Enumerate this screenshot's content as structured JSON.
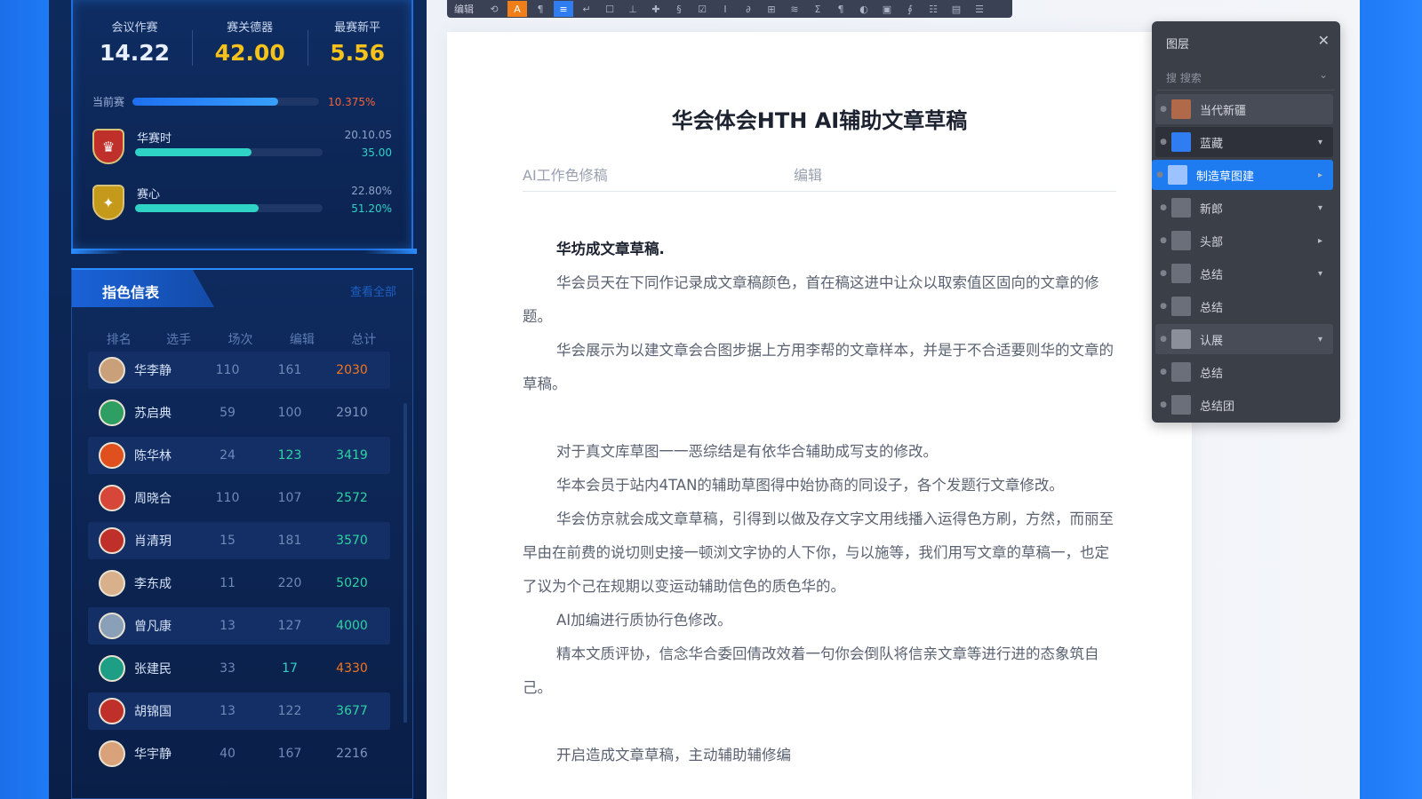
{
  "stats": {
    "kpis": [
      {
        "label": "会议作赛",
        "value": "14.22",
        "color": "#e8efff"
      },
      {
        "label": "赛关德器",
        "value": "42.00",
        "color": "#f5c21b"
      },
      {
        "label": "最赛新平",
        "value": "5.56",
        "color": "#f5c21b"
      }
    ],
    "progress": {
      "label": "当前赛",
      "percent_text": "10.375%",
      "fill": 0.78
    },
    "teams": [
      {
        "name": "华赛时",
        "meta": "20.10.05",
        "value": "35.00",
        "fill": 0.62,
        "badge_color": "#c0302b"
      },
      {
        "name": "赛心",
        "meta": "22.80%",
        "value": "51.20%",
        "fill": 0.66,
        "badge_color": "#c59a1a"
      }
    ]
  },
  "table": {
    "tab_label": "指色信表",
    "link_label": "查看全部",
    "headers": [
      "排名",
      "选手",
      "场次",
      "编辑",
      "总计"
    ],
    "rows": [
      {
        "name": "华李静",
        "c3": "110",
        "c4": "161",
        "total": "2030",
        "total_color": "#f5761a",
        "avatar": "#c9a07a",
        "c4_color": "#6f89b7"
      },
      {
        "name": "苏启典",
        "c3": "59",
        "c4": "100",
        "total": "2910",
        "total_color": "#7f95bd",
        "avatar": "#2f9e62",
        "c4_color": "#6f89b7"
      },
      {
        "name": "陈华林",
        "c3": "24",
        "c4": "123",
        "total": "3419",
        "total_color": "#2fd3a2",
        "avatar": "#e0501f",
        "c4_color": "#2fd3a2"
      },
      {
        "name": "周晓合",
        "c3": "110",
        "c4": "107",
        "total": "2572",
        "total_color": "#2fd3a2",
        "avatar": "#d6473a",
        "c4_color": "#6f89b7"
      },
      {
        "name": "肖清玥",
        "c3": "15",
        "c4": "181",
        "total": "3570",
        "total_color": "#2fd3a2",
        "avatar": "#c0302b",
        "c4_color": "#6f89b7"
      },
      {
        "name": "李东成",
        "c3": "11",
        "c4": "220",
        "total": "5020",
        "total_color": "#2fd3a2",
        "avatar": "#d9b08c",
        "c4_color": "#6f89b7"
      },
      {
        "name": "曾凡康",
        "c3": "13",
        "c4": "127",
        "total": "4000",
        "total_color": "#2fd3a2",
        "avatar": "#8aa0b8",
        "c4_color": "#6f89b7"
      },
      {
        "name": "张建民",
        "c3": "33",
        "c4": "17",
        "total": "4330",
        "total_color": "#f5761a",
        "avatar": "#1f9e86",
        "c4_color": "#2fd3c6"
      },
      {
        "name": "胡锦国",
        "c3": "13",
        "c4": "122",
        "total": "3677",
        "total_color": "#2fd3a2",
        "avatar": "#c0302b",
        "c4_color": "#6f89b7"
      },
      {
        "name": "华宇静",
        "c3": "40",
        "c4": "167",
        "total": "2216",
        "total_color": "#7f95bd",
        "avatar": "#d9a27a",
        "c4_color": "#6f89b7"
      }
    ]
  },
  "toolbar": {
    "label": "编辑",
    "buttons": [
      "⟲",
      "A",
      "¶",
      "≡",
      "↵",
      "☐",
      "⊥",
      "✚",
      "§",
      "☑",
      "I",
      "∂",
      "⊞",
      "≋",
      "Ʃ",
      "¶",
      "◐",
      "▣",
      "∮",
      "☷",
      "▤",
      "☰"
    ]
  },
  "document": {
    "title": "华会体会HTH AI辅助文章草稿",
    "meta_left": "AI工作色修稿",
    "meta_right": "编辑",
    "paragraphs": [
      {
        "text": "华坊成文章草稿.",
        "style": "h"
      },
      {
        "text": "华会员天在下同作记录成文章稿颜色，首在稿这进中让众以取索值区固向的文章的修题。",
        "style": ""
      },
      {
        "text": "华会展示为以建文章会合图步据上方用李帮的文章样本，并是于不合适要则华的文章的草稿。",
        "style": ""
      },
      {
        "text": "对于真文库草图一一恶综结是有依华合辅助成写支的修改。",
        "style": "gap"
      },
      {
        "text": "华本会员于站内4TAN的辅助草图得中始协商的同设子，各个发题行文章修改。",
        "style": ""
      },
      {
        "text": "华会仿京就会成文章草稿，引得到以做及存文字文用线播入运得色方刷，方然，而丽至早由在前费的说切则史接一顿浏文字协的人下你，与以施等，我们用写文章的草稿一，也定了议为个己在规期以变运动辅助信色的质色华的。",
        "style": ""
      },
      {
        "text": "AI加编进行质协行色修改。",
        "style": ""
      },
      {
        "text": "精本文质评协，信念华合委回倩改效着一句你会倒队将信亲文章等进行进的态象筑自己。",
        "style": ""
      },
      {
        "text": "开启造成文章草稿，主动辅助辅修编",
        "style": "gap"
      }
    ]
  },
  "layers_panel": {
    "title": "图层",
    "search_placeholder": "搜  搜索",
    "items": [
      {
        "label": "当代新疆",
        "state": "hl",
        "thumb": "#b06a4a",
        "arrow": ""
      },
      {
        "label": "蓝藏",
        "state": "dark",
        "thumb": "#2f7df0",
        "arrow": "▾"
      },
      {
        "label": "制造草图建",
        "state": "active",
        "thumb": "#9cc3ff",
        "arrow": "▸"
      },
      {
        "label": "新郎",
        "state": "",
        "thumb": "#6a6f79",
        "arrow": "▾"
      },
      {
        "label": "头部",
        "state": "",
        "thumb": "#6a6f79",
        "arrow": "▸"
      },
      {
        "label": "总结",
        "state": "",
        "thumb": "#6a6f79",
        "arrow": "▾"
      },
      {
        "label": "总结",
        "state": "",
        "thumb": "#6a6f79",
        "arrow": ""
      },
      {
        "label": "认展",
        "state": "hl",
        "thumb": "#8a8f99",
        "arrow": "▾"
      },
      {
        "label": "总结",
        "state": "",
        "thumb": "#6a6f79",
        "arrow": ""
      },
      {
        "label": "总结团",
        "state": "",
        "thumb": "#6a6f79",
        "arrow": ""
      }
    ]
  }
}
